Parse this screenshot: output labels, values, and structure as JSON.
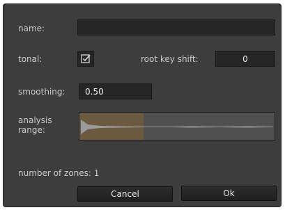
{
  "name": {
    "label": "name:",
    "value": ""
  },
  "tonal": {
    "label": "tonal:",
    "checked": true
  },
  "root_key_shift": {
    "label": "root key shift:",
    "value": "0"
  },
  "smoothing": {
    "label": "smoothing:",
    "value": "0.50"
  },
  "analysis_range": {
    "label_line1": "analysis",
    "label_line2": "range:",
    "selection_fraction": 0.33,
    "highlight_color": "#6b5a3f"
  },
  "zones": {
    "text": "number of zones: 1"
  },
  "buttons": {
    "cancel": "Cancel",
    "ok": "Ok"
  },
  "icons": {
    "checkbox": "checkmark-icon"
  }
}
